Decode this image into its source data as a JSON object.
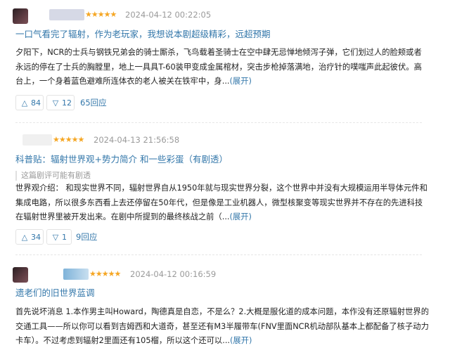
{
  "reviews": [
    {
      "stars": "★★★★★",
      "time": "2024-04-12 00:22:05",
      "title": "一口气看完了辐射，作为老玩家，我想说本剧超级精彩，远超预期",
      "spoiler_note": "",
      "body_lines": [
        "夕阳下，NCR的士兵与钢铁兄弟会的骑士厮杀，飞鸟载着圣骑士在空中肆无忌惮地倾泻子弹，它们划过人的脸颊或者",
        "永远的停在了士兵的胸膛里，地上一具具T-60装甲变成金属棺材，突击步枪掉落满地，治疗针的噗嗤声此起彼伏。高",
        "台上，一个身着蓝色避难所连体衣的老人被关在铁牢中，身..."
      ],
      "expand_label": "(展开)",
      "useful_count": "84",
      "useless_count": "12",
      "reply_label": "65回应"
    },
    {
      "stars": "★★★★★",
      "time": "2024-04-13 21:56:58",
      "title": "科普贴：辐射世界观+势力简介 和一些彩蛋（有剧透）",
      "spoiler_note": "这篇剧评可能有剧透",
      "body_lines": [
        "世界观介绍： 和现实世界不同，辐射世界自从1950年就与现实世界分裂，这个世界中并没有大规模运用半导体元件和",
        "集成电路，所以很多东西看上去还停留在50年代，但是像是工业机器人，微型核聚变等现实世界并不存在的先进科技",
        "在辐射世界里被开发出来。在剧中所提到的最终核战之前（..."
      ],
      "expand_label": "(展开)",
      "useful_count": "34",
      "useless_count": "1",
      "reply_label": "9回应"
    },
    {
      "stars": "★★★★★",
      "time": "2024-04-12 00:16:59",
      "title": "遗老们的旧世界蓝调",
      "spoiler_note": "",
      "body_lines": [
        "首先说坏消息 1.本作男主叫Howard，陶德真是自恋，不是么？2.大概是服化道的成本问题，本作没有还原辐射世界的",
        "交通工具——所以你可以看到吉姆西和大道奇，甚至还有M3半履带车(FNV里面NCR机动部队基本上都配备了核子动力",
        "卡车）。不过考虑到辐射2里面还有105榴，所以这个还可以..."
      ],
      "expand_label": "(展开)"
    }
  ],
  "icons": {
    "up": "△",
    "down": "▽"
  },
  "colors": {
    "link": "#3377aa",
    "star": "#f5a623",
    "meta": "#9a9a9a"
  }
}
